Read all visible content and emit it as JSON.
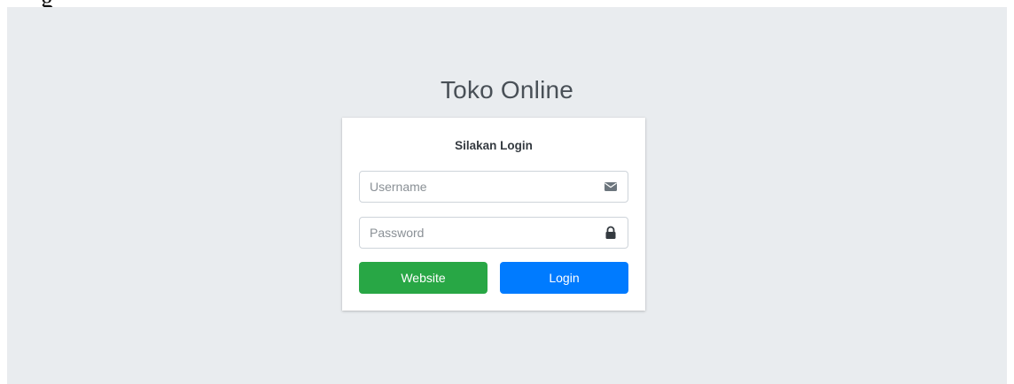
{
  "stray_text": "g",
  "app": {
    "title": "Toko Online"
  },
  "login_card": {
    "heading": "Silakan Login",
    "username": {
      "value": "",
      "placeholder": "Username",
      "icon": "envelope-icon"
    },
    "password": {
      "value": "",
      "placeholder": "Password",
      "icon": "lock-icon"
    },
    "buttons": {
      "website_label": "Website",
      "login_label": "Login"
    }
  },
  "colors": {
    "page_background": "#e9ecef",
    "card_background": "#ffffff",
    "website_button": "#28a745",
    "login_button": "#007bff",
    "border": "#ced4da",
    "icon": "#6c757d"
  }
}
